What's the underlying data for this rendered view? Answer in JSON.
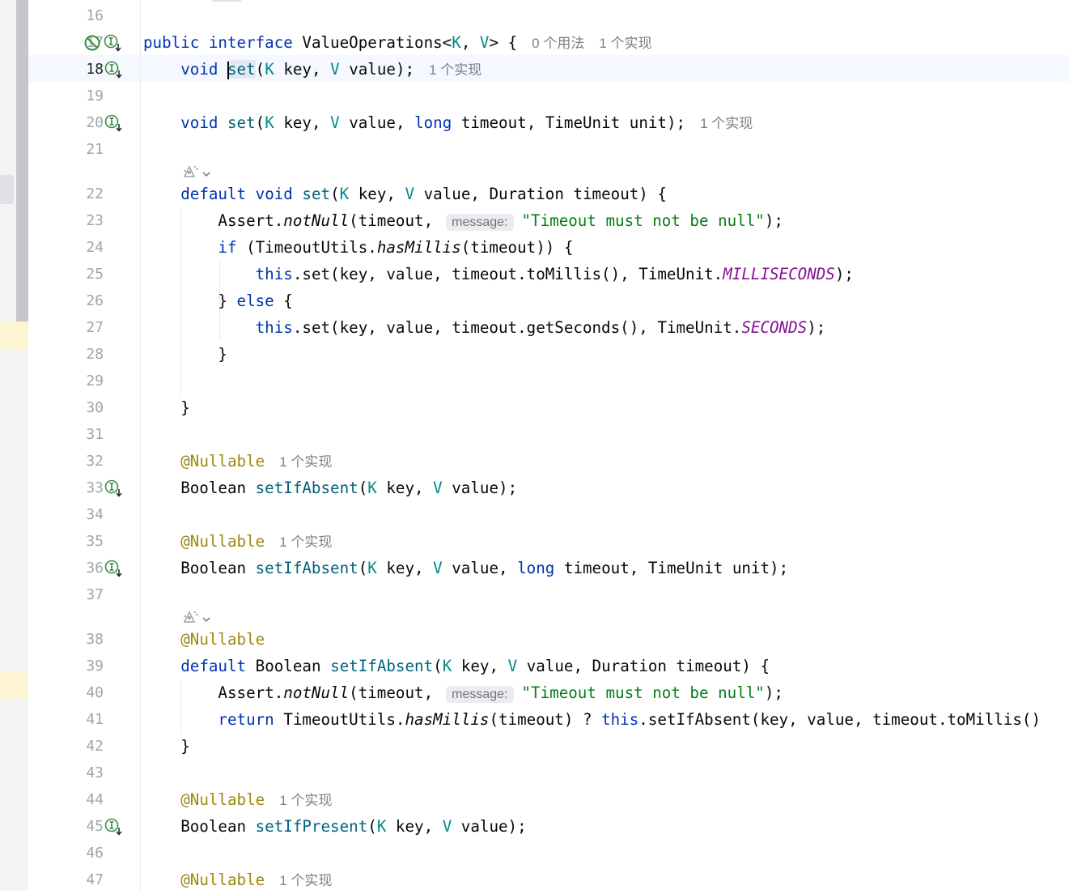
{
  "editor": {
    "caret_line": "18",
    "lines": [
      {
        "num": "16",
        "icons": [],
        "code": []
      },
      {
        "num": "17",
        "icons": [
          "no-entry-icon",
          "implemented-interface-icon"
        ],
        "code": [
          {
            "t": "public ",
            "c": "kw"
          },
          {
            "t": "interface ",
            "c": "kw"
          },
          {
            "t": "ValueOperations<"
          },
          {
            "t": "K",
            "c": "tp"
          },
          {
            "t": ", "
          },
          {
            "t": "V",
            "c": "tp"
          },
          {
            "t": "> {"
          },
          {
            "t": "0 个用法",
            "c": "inlay"
          },
          {
            "t": "1 个实现",
            "c": "inlay"
          }
        ]
      },
      {
        "num": "18",
        "icons": [
          "implemented-interface-icon"
        ],
        "current": true,
        "code": [
          {
            "t": "    "
          },
          {
            "t": "void ",
            "c": "kw"
          },
          {
            "caret": true
          },
          {
            "t": "set",
            "c": "fn",
            "hl": true
          },
          {
            "t": "("
          },
          {
            "t": "K",
            "c": "tp"
          },
          {
            "t": " key, "
          },
          {
            "t": "V",
            "c": "tp"
          },
          {
            "t": " value);"
          },
          {
            "t": "1 个实现",
            "c": "inlay"
          }
        ]
      },
      {
        "num": "19",
        "icons": [],
        "code": []
      },
      {
        "num": "20",
        "icons": [
          "implemented-interface-icon"
        ],
        "code": [
          {
            "t": "    "
          },
          {
            "t": "void ",
            "c": "kw"
          },
          {
            "t": "set",
            "c": "fn"
          },
          {
            "t": "("
          },
          {
            "t": "K",
            "c": "tp"
          },
          {
            "t": " key, "
          },
          {
            "t": "V",
            "c": "tp"
          },
          {
            "t": " value, "
          },
          {
            "t": "long",
            "c": "kw"
          },
          {
            "t": " timeout, TimeUnit unit);"
          },
          {
            "t": "1 个实现",
            "c": "inlay"
          }
        ]
      },
      {
        "num": "21",
        "icons": [],
        "code": []
      },
      {
        "num": "22",
        "icons": [],
        "hint_above": "ai-sparkle-icon",
        "code": [
          {
            "t": "    "
          },
          {
            "t": "default ",
            "c": "kw"
          },
          {
            "t": "void ",
            "c": "kw"
          },
          {
            "t": "set",
            "c": "fn"
          },
          {
            "t": "("
          },
          {
            "t": "K",
            "c": "tp"
          },
          {
            "t": " key, "
          },
          {
            "t": "V",
            "c": "tp"
          },
          {
            "t": " value, Duration timeout) {"
          }
        ]
      },
      {
        "num": "23",
        "icons": [],
        "code": [
          {
            "t": "        Assert."
          },
          {
            "t": "notNull",
            "c": "it"
          },
          {
            "t": "(timeout,"
          },
          {
            "t": "message:",
            "c": "phint"
          },
          {
            "t": "\"Timeout must not be null\"",
            "c": "st"
          },
          {
            "t": ");"
          }
        ]
      },
      {
        "num": "24",
        "icons": [],
        "code": [
          {
            "t": "        "
          },
          {
            "t": "if",
            "c": "kw"
          },
          {
            "t": " (TimeoutUtils."
          },
          {
            "t": "hasMillis",
            "c": "it"
          },
          {
            "t": "(timeout)) {"
          }
        ]
      },
      {
        "num": "25",
        "icons": [],
        "code": [
          {
            "t": "            "
          },
          {
            "t": "this",
            "c": "kw"
          },
          {
            "t": ".set(key, value, timeout.toMillis(), TimeUnit."
          },
          {
            "t": "MILLISECONDS",
            "c": "cs"
          },
          {
            "t": ");"
          }
        ]
      },
      {
        "num": "26",
        "icons": [],
        "code": [
          {
            "t": "        } "
          },
          {
            "t": "else",
            "c": "kw"
          },
          {
            "t": " {"
          }
        ]
      },
      {
        "num": "27",
        "icons": [],
        "code": [
          {
            "t": "            "
          },
          {
            "t": "this",
            "c": "kw"
          },
          {
            "t": ".set(key, value, timeout.getSeconds(), TimeUnit."
          },
          {
            "t": "SECONDS",
            "c": "cs"
          },
          {
            "t": ");"
          }
        ]
      },
      {
        "num": "28",
        "icons": [],
        "code": [
          {
            "t": "        }"
          }
        ]
      },
      {
        "num": "29",
        "icons": [],
        "code": []
      },
      {
        "num": "30",
        "icons": [],
        "code": [
          {
            "t": "    }"
          }
        ]
      },
      {
        "num": "31",
        "icons": [],
        "code": []
      },
      {
        "num": "32",
        "icons": [],
        "code": [
          {
            "t": "    "
          },
          {
            "t": "@Nullable",
            "c": "an"
          },
          {
            "t": "1 个实现",
            "c": "inlay"
          }
        ]
      },
      {
        "num": "33",
        "icons": [
          "implemented-interface-icon"
        ],
        "code": [
          {
            "t": "    Boolean "
          },
          {
            "t": "setIfAbsent",
            "c": "fn"
          },
          {
            "t": "("
          },
          {
            "t": "K",
            "c": "tp"
          },
          {
            "t": " key, "
          },
          {
            "t": "V",
            "c": "tp"
          },
          {
            "t": " value);"
          }
        ]
      },
      {
        "num": "34",
        "icons": [],
        "code": []
      },
      {
        "num": "35",
        "icons": [],
        "code": [
          {
            "t": "    "
          },
          {
            "t": "@Nullable",
            "c": "an"
          },
          {
            "t": "1 个实现",
            "c": "inlay"
          }
        ]
      },
      {
        "num": "36",
        "icons": [
          "implemented-interface-icon"
        ],
        "code": [
          {
            "t": "    Boolean "
          },
          {
            "t": "setIfAbsent",
            "c": "fn"
          },
          {
            "t": "("
          },
          {
            "t": "K",
            "c": "tp"
          },
          {
            "t": " key, "
          },
          {
            "t": "V",
            "c": "tp"
          },
          {
            "t": " value, "
          },
          {
            "t": "long",
            "c": "kw"
          },
          {
            "t": " timeout, TimeUnit unit);"
          }
        ]
      },
      {
        "num": "37",
        "icons": [],
        "code": []
      },
      {
        "num": "38",
        "icons": [],
        "hint_above": "ai-sparkle-icon",
        "code": [
          {
            "t": "    "
          },
          {
            "t": "@Nullable",
            "c": "an"
          }
        ]
      },
      {
        "num": "39",
        "icons": [],
        "code": [
          {
            "t": "    "
          },
          {
            "t": "default ",
            "c": "kw"
          },
          {
            "t": "Boolean "
          },
          {
            "t": "setIfAbsent",
            "c": "fn"
          },
          {
            "t": "("
          },
          {
            "t": "K",
            "c": "tp"
          },
          {
            "t": " key, "
          },
          {
            "t": "V",
            "c": "tp"
          },
          {
            "t": " value, Duration timeout) {"
          }
        ]
      },
      {
        "num": "40",
        "icons": [],
        "code": [
          {
            "t": "        Assert."
          },
          {
            "t": "notNull",
            "c": "it"
          },
          {
            "t": "(timeout,"
          },
          {
            "t": "message:",
            "c": "phint"
          },
          {
            "t": "\"Timeout must not be null\"",
            "c": "st"
          },
          {
            "t": ");"
          }
        ]
      },
      {
        "num": "41",
        "icons": [],
        "code": [
          {
            "t": "        "
          },
          {
            "t": "return",
            "c": "kw"
          },
          {
            "t": " TimeoutUtils."
          },
          {
            "t": "hasMillis",
            "c": "it"
          },
          {
            "t": "(timeout) ? "
          },
          {
            "t": "this",
            "c": "kw"
          },
          {
            "t": ".setIfAbsent(key, value, timeout.toMillis()"
          }
        ]
      },
      {
        "num": "42",
        "icons": [],
        "code": [
          {
            "t": "    }"
          }
        ]
      },
      {
        "num": "43",
        "icons": [],
        "code": []
      },
      {
        "num": "44",
        "icons": [],
        "code": [
          {
            "t": "    "
          },
          {
            "t": "@Nullable",
            "c": "an"
          },
          {
            "t": "1 个实现",
            "c": "inlay"
          }
        ]
      },
      {
        "num": "45",
        "icons": [
          "implemented-interface-icon"
        ],
        "code": [
          {
            "t": "    Boolean "
          },
          {
            "t": "setIfPresent",
            "c": "fn"
          },
          {
            "t": "("
          },
          {
            "t": "K",
            "c": "tp"
          },
          {
            "t": " key, "
          },
          {
            "t": "V",
            "c": "tp"
          },
          {
            "t": " value);"
          }
        ]
      },
      {
        "num": "46",
        "icons": [],
        "code": []
      },
      {
        "num": "47",
        "icons": [],
        "code": [
          {
            "t": "    "
          },
          {
            "t": "@Nullable",
            "c": "an"
          },
          {
            "t": "1 个实现",
            "c": "inlay"
          }
        ]
      }
    ]
  }
}
